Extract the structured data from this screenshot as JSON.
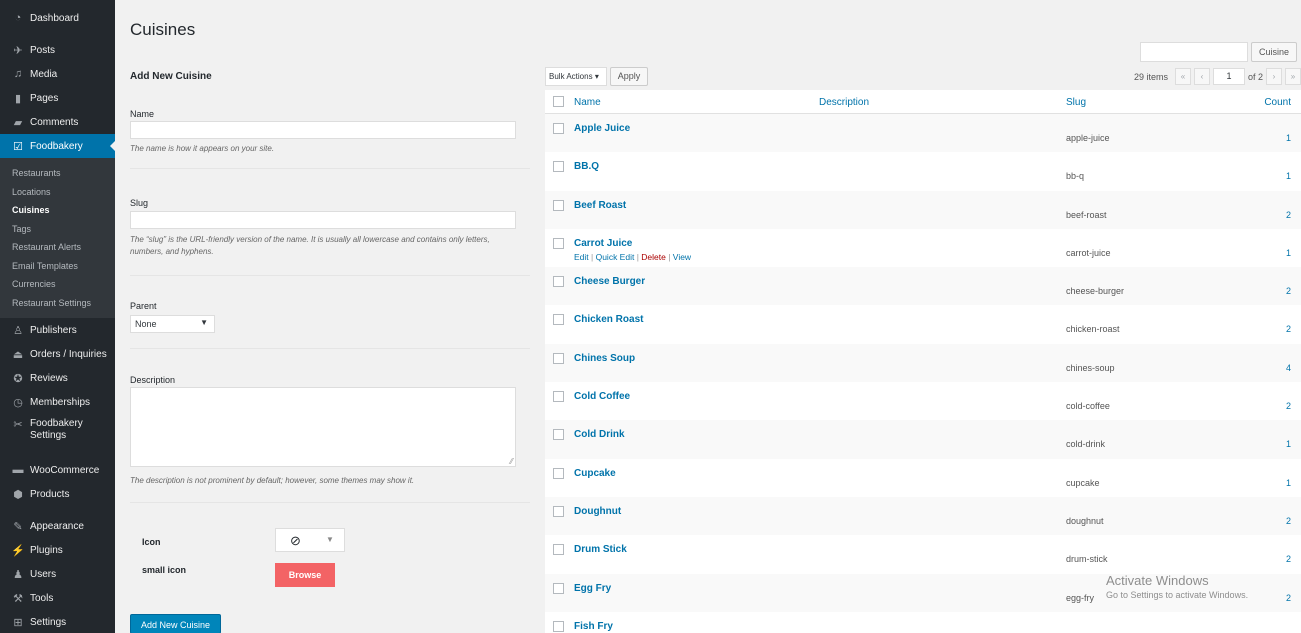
{
  "sidebar": {
    "top_items": [
      {
        "label": "Dashboard",
        "icon": "dashboard-icon"
      },
      {
        "label": "Posts",
        "icon": "pin-icon"
      },
      {
        "label": "Media",
        "icon": "media-icon"
      },
      {
        "label": "Pages",
        "icon": "pages-icon"
      },
      {
        "label": "Comments",
        "icon": "comment-icon"
      },
      {
        "label": "Foodbakery",
        "icon": "foodbakery-icon"
      }
    ],
    "submenu": [
      "Restaurants",
      "Locations",
      "Cuisines",
      "Tags",
      "Restaurant Alerts",
      "Email Templates",
      "Currencies",
      "Restaurant Settings"
    ],
    "bottom_items": [
      {
        "label": "Publishers",
        "icon": "publishers-icon"
      },
      {
        "label": "Orders / Inquiries",
        "icon": "orders-icon"
      },
      {
        "label": "Reviews",
        "icon": "reviews-icon"
      },
      {
        "label": "Memberships",
        "icon": "memberships-icon"
      },
      {
        "label": "Foodbakery Settings",
        "icon": "tools-cross-icon"
      },
      {
        "label": "WooCommerce",
        "icon": "woocommerce-icon"
      },
      {
        "label": "Products",
        "icon": "products-icon"
      },
      {
        "label": "Appearance",
        "icon": "appearance-icon"
      },
      {
        "label": "Plugins",
        "icon": "plugins-icon"
      },
      {
        "label": "Users",
        "icon": "users-icon"
      },
      {
        "label": "Tools",
        "icon": "tools-icon"
      },
      {
        "label": "Settings",
        "icon": "settings-icon"
      }
    ],
    "foodbakery_settings_line1": "Foodbakery",
    "foodbakery_settings_line2": "Settings"
  },
  "page": {
    "title": "Cuisines"
  },
  "form": {
    "heading": "Add New Cuisine",
    "name_label": "Name",
    "name_value": "",
    "name_help": "The name is how it appears on your site.",
    "slug_label": "Slug",
    "slug_value": "",
    "slug_help": "The “slug” is the URL-friendly version of the name. It is usually all lowercase and contains only letters, numbers, and hyphens.",
    "parent_label": "Parent",
    "parent_value": "None",
    "description_label": "Description",
    "description_help": "The description is not prominent by default; however, some themes may show it.",
    "icon_label": "Icon",
    "small_icon_label": "small icon",
    "browse_label": "Browse",
    "submit_label": "Add New Cuisine"
  },
  "toolbar": {
    "search_value": "",
    "search_button": "Cuisine",
    "bulk_actions": "Bulk Actions",
    "apply": "Apply",
    "items_count": "29 items",
    "first_page": "«",
    "prev_page": "‹",
    "current_page": "1",
    "total_pages": "of 2",
    "next_page": "›",
    "last_page": "»"
  },
  "table": {
    "headers": {
      "name": "Name",
      "description": "Description",
      "slug": "Slug",
      "count": "Count"
    },
    "rows": [
      {
        "name": "Apple Juice",
        "slug": "apple-juice",
        "count": "1"
      },
      {
        "name": "BB.Q",
        "slug": "bb-q",
        "count": "1"
      },
      {
        "name": "Beef Roast",
        "slug": "beef-roast",
        "count": "2"
      },
      {
        "name": "Carrot Juice",
        "slug": "carrot-juice",
        "count": "1"
      },
      {
        "name": "Cheese Burger",
        "slug": "cheese-burger",
        "count": "2"
      },
      {
        "name": "Chicken Roast",
        "slug": "chicken-roast",
        "count": "2"
      },
      {
        "name": "Chines Soup",
        "slug": "chines-soup",
        "count": "4"
      },
      {
        "name": "Cold Coffee",
        "slug": "cold-coffee",
        "count": "2"
      },
      {
        "name": "Cold Drink",
        "slug": "cold-drink",
        "count": "1"
      },
      {
        "name": "Cupcake",
        "slug": "cupcake",
        "count": "1"
      },
      {
        "name": "Doughnut",
        "slug": "doughnut",
        "count": "2"
      },
      {
        "name": "Drum Stick",
        "slug": "drum-stick",
        "count": "2"
      },
      {
        "name": "Egg Fry",
        "slug": "egg-fry",
        "count": "2"
      },
      {
        "name": "Fish Fry",
        "slug": "",
        "count": ""
      }
    ],
    "row_actions": {
      "edit": "Edit",
      "quick_edit": "Quick Edit",
      "delete": "Delete",
      "view": "View"
    }
  },
  "watermark": {
    "title": "Activate Windows",
    "subtitle": "Go to Settings to activate Windows."
  }
}
